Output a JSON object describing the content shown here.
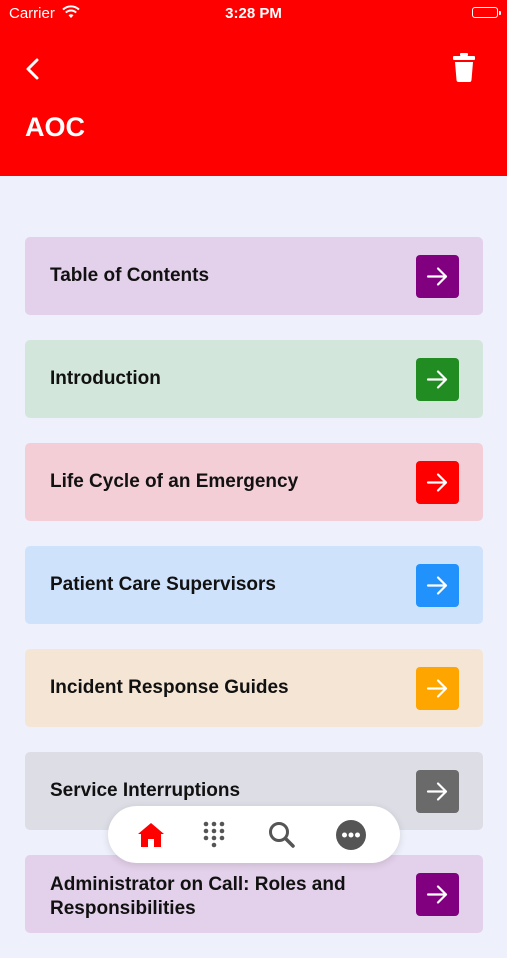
{
  "status_bar": {
    "carrier": "Carrier",
    "time": "3:28 PM"
  },
  "header": {
    "title": "AOC",
    "background": "#fe0000"
  },
  "items": [
    {
      "label": "Table of Contents",
      "bg": "#e3d0ea",
      "accent": "#800080"
    },
    {
      "label": "Introduction",
      "bg": "#d3e6db",
      "accent": "#218c21"
    },
    {
      "label": "Life Cycle of an Emergency",
      "bg": "#f4ced6",
      "accent": "#fe0000"
    },
    {
      "label": "Patient Care Supervisors",
      "bg": "#cfe2fb",
      "accent": "#2191fb"
    },
    {
      "label": "Incident Response Guides",
      "bg": "#f4e5d5",
      "accent": "#fea500"
    },
    {
      "label": "Service Interruptions",
      "bg": "#dcdde5",
      "accent": "#6a6a6a"
    },
    {
      "label": "Administrator on Call:  Roles and Responsibilities",
      "bg": "#e3d0ea",
      "accent": "#800080"
    }
  ],
  "tab_bar": {
    "tabs": [
      {
        "icon": "home-icon",
        "active": true,
        "color": "#fe0000"
      },
      {
        "icon": "keypad-icon",
        "active": false,
        "color": "#555555"
      },
      {
        "icon": "search-icon",
        "active": false,
        "color": "#555555"
      },
      {
        "icon": "more-icon",
        "active": false,
        "color": "#555555"
      }
    ]
  }
}
